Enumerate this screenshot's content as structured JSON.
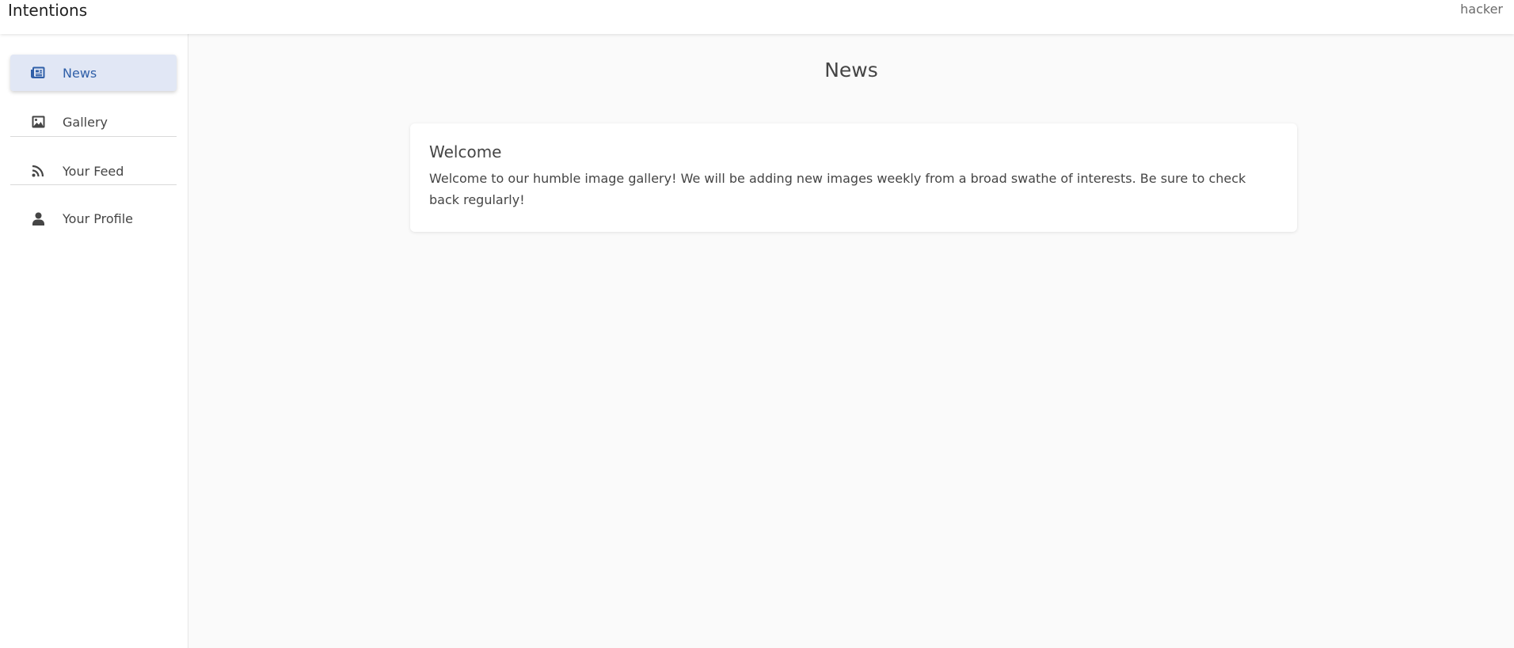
{
  "app": {
    "title": "Intentions",
    "username": "hacker"
  },
  "sidebar": {
    "items": [
      {
        "label": "News",
        "icon": "newspaper-icon",
        "active": true
      },
      {
        "label": "Gallery",
        "icon": "image-icon",
        "active": false
      },
      {
        "label": "Your Feed",
        "icon": "rss-icon",
        "active": false
      },
      {
        "label": "Your Profile",
        "icon": "user-icon",
        "active": false
      }
    ]
  },
  "main": {
    "heading": "News",
    "cards": [
      {
        "title": "Welcome",
        "body": "Welcome to our humble image gallery! We will be adding new images weekly from a broad swathe of interests. Be sure to check back regularly!"
      }
    ]
  },
  "colors": {
    "active_bg": "#e1e7f5",
    "active_text": "#2f5fa8",
    "page_bg": "#fafafa"
  }
}
